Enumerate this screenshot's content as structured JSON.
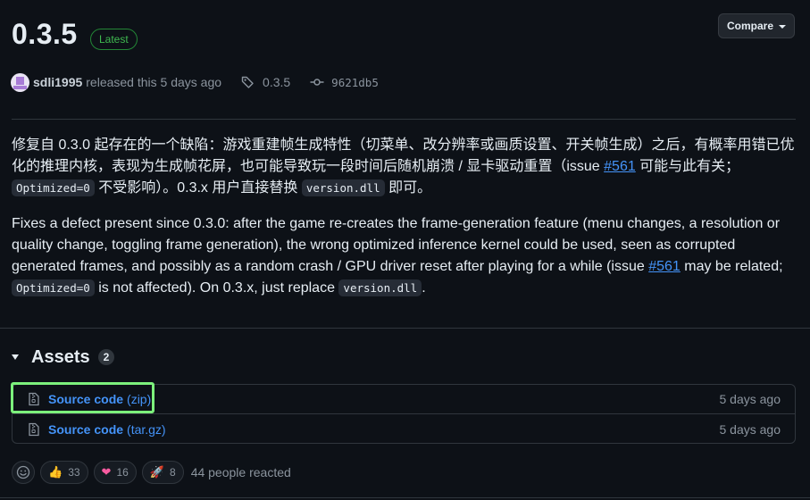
{
  "release": {
    "version": "0.3.5",
    "badge": "Latest",
    "compare_label": "Compare",
    "author": "sdli1995",
    "released_text": "released this 5 days ago",
    "tag": "0.3.5",
    "commit": "9621db5"
  },
  "notes": {
    "zh": {
      "p1": "修复自 0.3.0 起存在的一个缺陷：游戏重建帧生成特性（切菜单、改分辨率或画质设置、开关帧生成）之后，有概率用错已优化的推理内核，表现为生成帧花屏，也可能导致玩一段时间后随机崩溃 / 显卡驱动重置（issue ",
      "issue_link": "#561",
      "p2": " 可能与此有关；",
      "code1": "Optimized=0",
      "p3": " 不受影响）。0.3.x 用户直接替换 ",
      "code2": "version.dll",
      "p4": " 即可。"
    },
    "en": {
      "p1": "Fixes a defect present since 0.3.0: after the game re-creates the frame-generation feature (menu changes, a resolution or quality change, toggling frame generation), the wrong optimized inference kernel could be used, seen as corrupted generated frames, and possibly as a random crash / GPU driver reset after playing for a while (issue ",
      "issue_link": "#561",
      "p2": " may be related; ",
      "code1": "Optimized=0",
      "p3": " is not affected). On 0.3.x, just replace ",
      "code2": "version.dll",
      "p4": "."
    }
  },
  "assets": {
    "title": "Assets",
    "count": "2",
    "items": [
      {
        "name": "Source code",
        "ext": "(zip)",
        "time": "5 days ago"
      },
      {
        "name": "Source code",
        "ext": "(tar.gz)",
        "time": "5 days ago"
      }
    ]
  },
  "reactions": {
    "items": [
      {
        "emoji": "👍",
        "icon": "thumbs-up-icon",
        "count": "33"
      },
      {
        "emoji": "❤",
        "icon": "heart-icon",
        "count": "16"
      },
      {
        "emoji": "🚀",
        "icon": "rocket-icon",
        "count": "8"
      }
    ],
    "summary": "44 people reacted"
  },
  "colors": {
    "background": "#0d1117",
    "link": "#4493f8",
    "badge_green": "#3fb950",
    "highlight": "#7cf07c"
  }
}
